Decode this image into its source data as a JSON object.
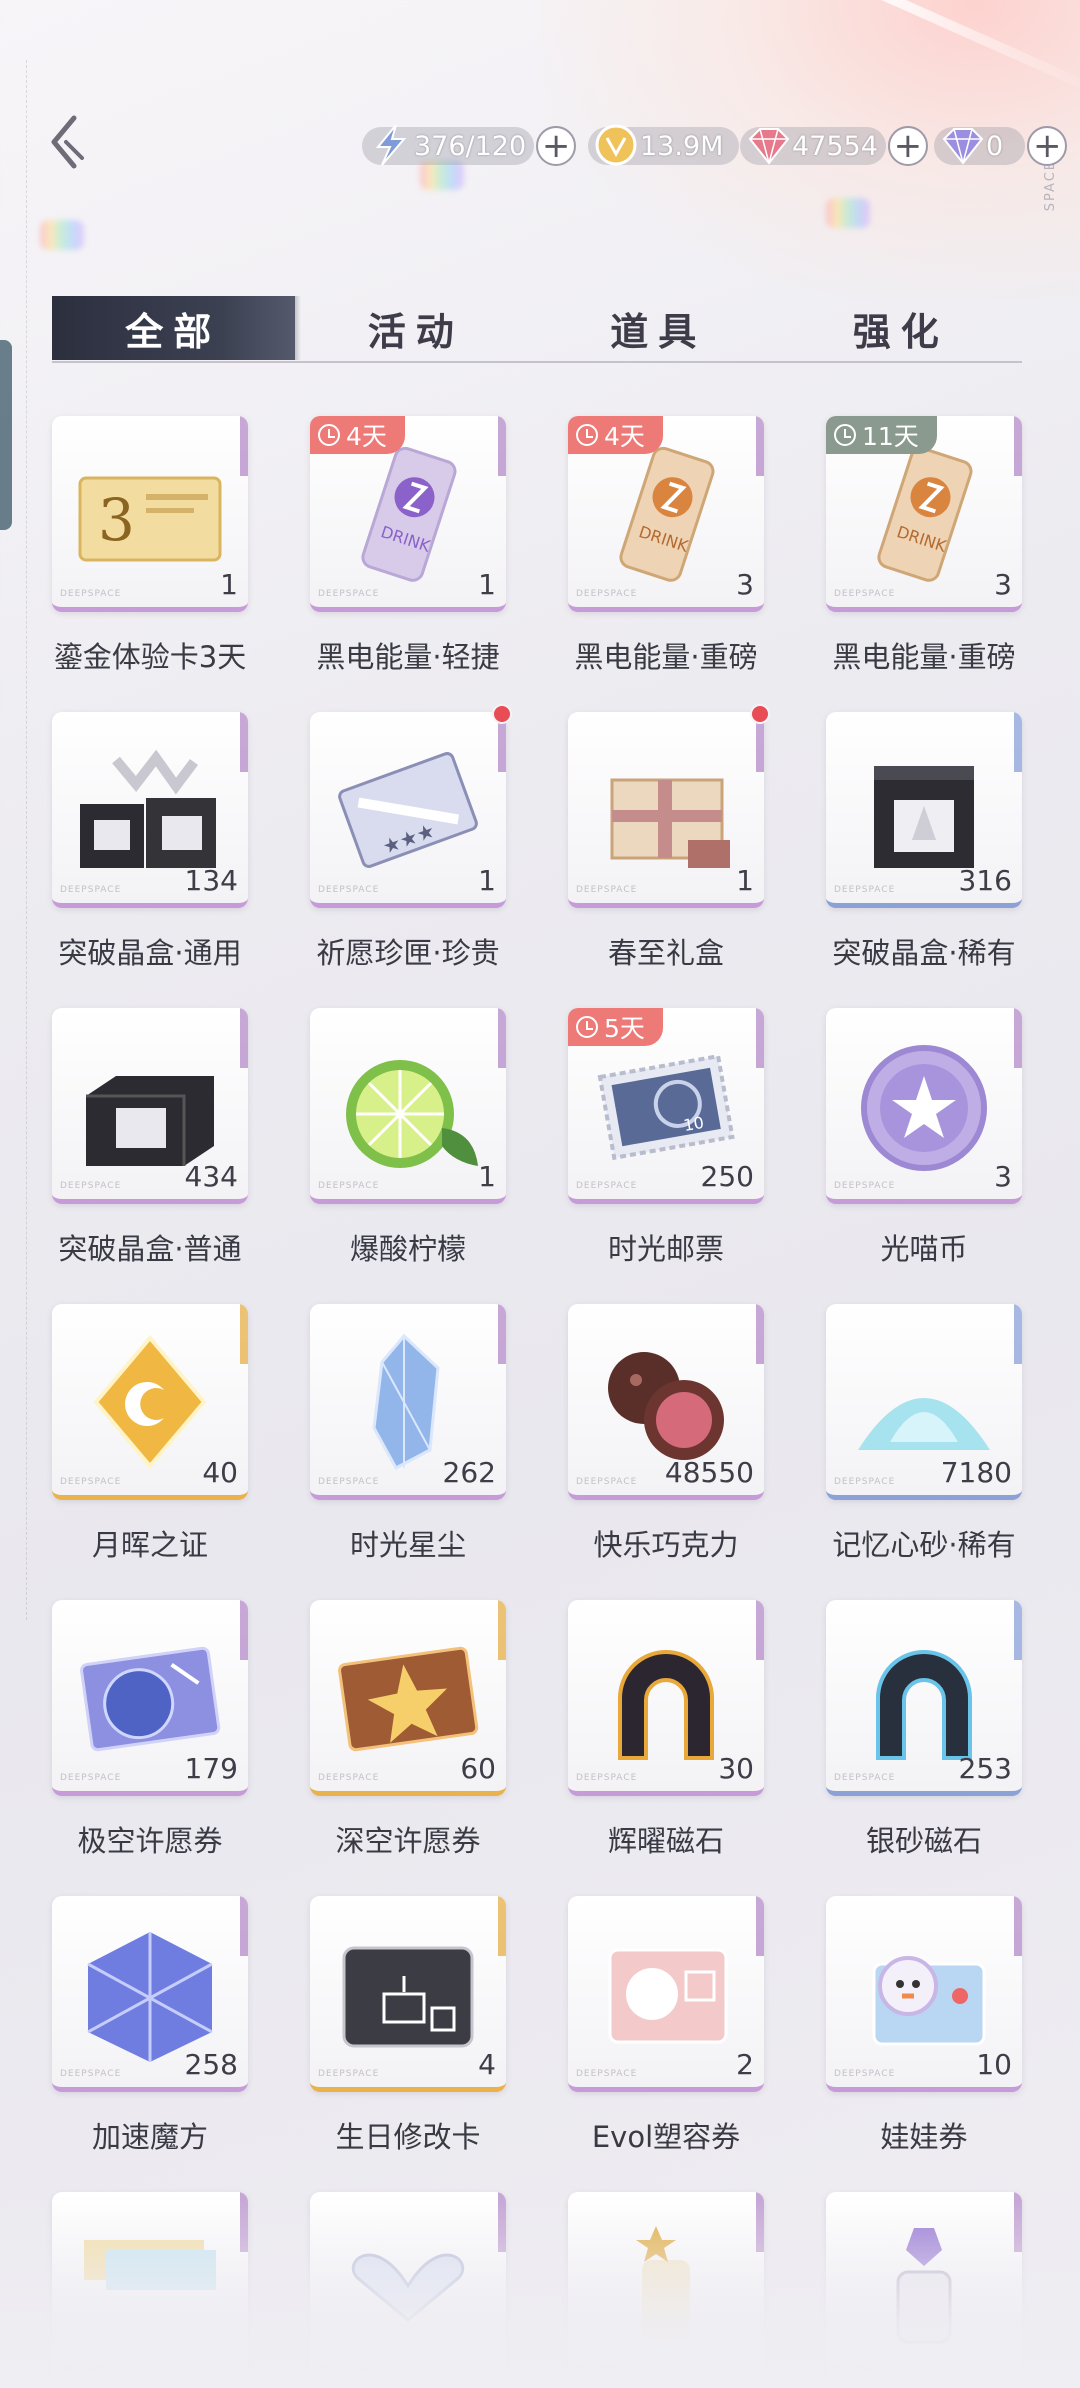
{
  "header": {
    "side_label": "SPACE",
    "resources": [
      {
        "icon": "stamina-icon",
        "value": "376/120",
        "has_plus": true
      },
      {
        "icon": "gold-coin-icon",
        "value": "13.9M",
        "has_plus": false
      },
      {
        "icon": "red-gem-icon",
        "value": "47554",
        "has_plus": true
      },
      {
        "icon": "purple-diamond-icon",
        "value": "0",
        "has_plus": true
      }
    ],
    "plus_symbol": "+"
  },
  "tabs": [
    {
      "label": "全部",
      "active": true
    },
    {
      "label": "活动",
      "active": false
    },
    {
      "label": "道具",
      "active": false
    },
    {
      "label": "强化",
      "active": false
    }
  ],
  "card_watermark": "DEEPSPACE",
  "items": [
    {
      "name": "鎏金体验卡3天",
      "count": "1",
      "icon": "gold-trial-card-icon",
      "rarity": "purple"
    },
    {
      "name": "黑电能量·轻捷",
      "count": "1",
      "icon": "purple-drink-can-icon",
      "rarity": "purple",
      "timer": "4天"
    },
    {
      "name": "黑电能量·重磅",
      "count": "3",
      "icon": "orange-drink-can-icon",
      "rarity": "purple",
      "timer": "4天"
    },
    {
      "name": "黑电能量·重磅",
      "count": "3",
      "icon": "orange-drink-can-icon",
      "rarity": "purple",
      "timer": "11天",
      "timer_style": "grey"
    },
    {
      "name": "突破晶盒·通用",
      "count": "134",
      "icon": "crystal-box-multi-icon",
      "rarity": "purple"
    },
    {
      "name": "祈愿珍匣·珍贵",
      "count": "1",
      "icon": "wish-case-icon",
      "rarity": "purple",
      "badge": true
    },
    {
      "name": "春至礼盒",
      "count": "1",
      "icon": "gift-box-icon",
      "rarity": "purple",
      "badge": true
    },
    {
      "name": "突破晶盒·稀有",
      "count": "316",
      "icon": "crystal-box-icon",
      "rarity": "blue"
    },
    {
      "name": "突破晶盒·普通",
      "count": "434",
      "icon": "black-box-icon",
      "rarity": "purple"
    },
    {
      "name": "爆酸柠檬",
      "count": "1",
      "icon": "lime-icon",
      "rarity": "purple"
    },
    {
      "name": "时光邮票",
      "count": "250",
      "icon": "stamp-icon",
      "rarity": "purple",
      "timer": "5天"
    },
    {
      "name": "光喵币",
      "count": "3",
      "icon": "cat-coin-icon",
      "rarity": "purple"
    },
    {
      "name": "月晖之证",
      "count": "40",
      "icon": "moon-emblem-icon",
      "rarity": "gold"
    },
    {
      "name": "时光星尘",
      "count": "262",
      "icon": "star-crystal-icon",
      "rarity": "purple"
    },
    {
      "name": "快乐巧克力",
      "count": "48550",
      "icon": "chocolate-icon",
      "rarity": "purple"
    },
    {
      "name": "记忆心砂·稀有",
      "count": "7180",
      "icon": "sand-pile-icon",
      "rarity": "blue"
    },
    {
      "name": "极空许愿券",
      "count": "179",
      "icon": "planet-ticket-icon",
      "rarity": "purple"
    },
    {
      "name": "深空许愿券",
      "count": "60",
      "icon": "star-ticket-icon",
      "rarity": "gold"
    },
    {
      "name": "辉曜磁石",
      "count": "30",
      "icon": "gold-magnet-icon",
      "rarity": "purple"
    },
    {
      "name": "银砂磁石",
      "count": "253",
      "icon": "blue-magnet-icon",
      "rarity": "blue"
    },
    {
      "name": "加速魔方",
      "count": "258",
      "icon": "magic-cube-icon",
      "rarity": "purple"
    },
    {
      "name": "生日修改卡",
      "count": "4",
      "icon": "birthday-card-icon",
      "rarity": "gold"
    },
    {
      "name": "Evol塑容券",
      "count": "2",
      "icon": "evol-ticket-icon",
      "rarity": "purple"
    },
    {
      "name": "娃娃券",
      "count": "10",
      "icon": "doll-ticket-icon",
      "rarity": "purple"
    },
    {
      "name": "",
      "count": "",
      "icon": "ticket-stack-icon",
      "rarity": "purple"
    },
    {
      "name": "",
      "count": "",
      "icon": "crystal-heart-icon",
      "rarity": "purple"
    },
    {
      "name": "",
      "count": "",
      "icon": "star-bottle-icon",
      "rarity": "purple"
    },
    {
      "name": "",
      "count": "",
      "icon": "perfume-bottle-icon",
      "rarity": "purple"
    }
  ]
}
